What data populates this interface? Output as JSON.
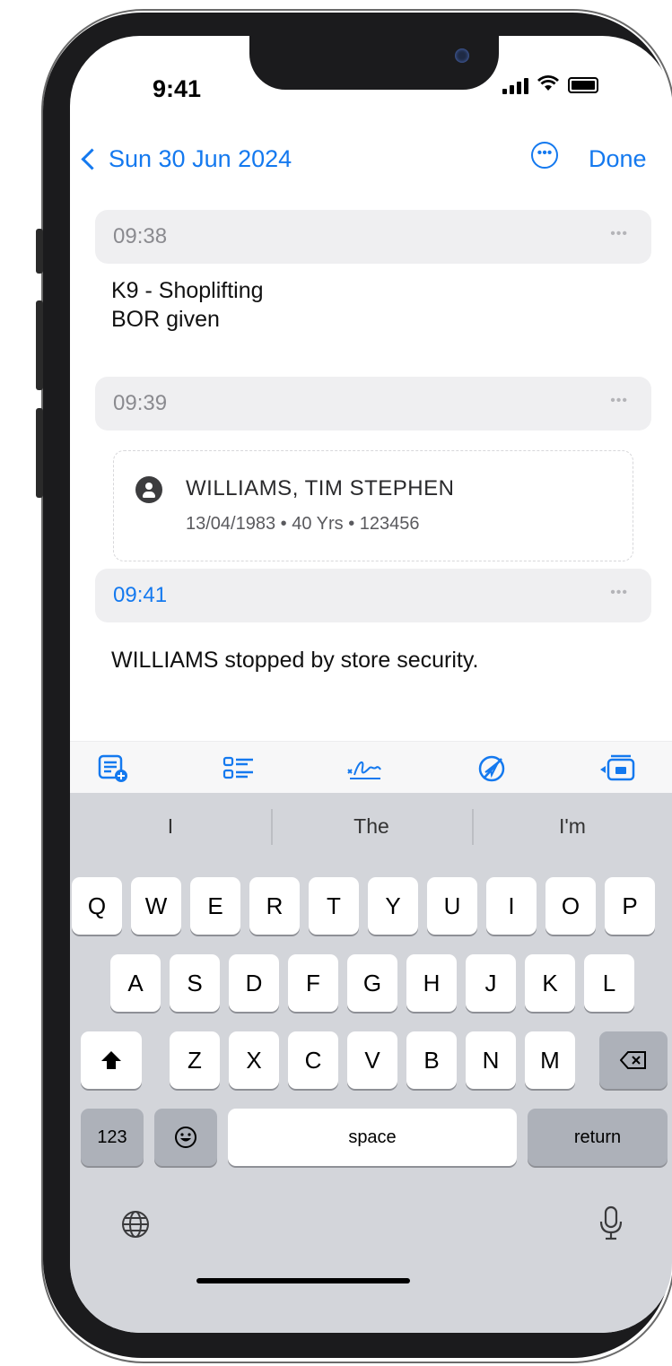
{
  "status_bar": {
    "time": "9:41"
  },
  "nav": {
    "back_label": "Sun 30 Jun 2024",
    "done_label": "Done",
    "more_icon": "ellipsis-circle-icon"
  },
  "entries": [
    {
      "time": "09:38",
      "text_lines": [
        "K9 - Shoplifting",
        "BOR given"
      ]
    },
    {
      "time": "09:39",
      "person": {
        "name": "WILLIAMS, TIM STEPHEN",
        "details": "13/04/1983 • 40 Yrs • 123456"
      }
    },
    {
      "time": "09:41",
      "text_lines": [
        "WILLIAMS stopped by store security."
      ]
    }
  ],
  "toolbar": {
    "icons": [
      "add-note-icon",
      "checklist-icon",
      "signature-icon",
      "no-location-icon",
      "camera-card-icon"
    ]
  },
  "keyboard": {
    "suggestions": [
      "I",
      "The",
      "I'm"
    ],
    "row1": [
      "Q",
      "W",
      "E",
      "R",
      "T",
      "Y",
      "U",
      "I",
      "O",
      "P"
    ],
    "row2": [
      "A",
      "S",
      "D",
      "F",
      "G",
      "H",
      "J",
      "K",
      "L"
    ],
    "row3": [
      "Z",
      "X",
      "C",
      "V",
      "B",
      "N",
      "M"
    ],
    "numbers_label": "123",
    "space_label": "space",
    "return_label": "return"
  },
  "colors": {
    "accent": "#1479ef",
    "keyboard_bg": "#d3d5da"
  }
}
